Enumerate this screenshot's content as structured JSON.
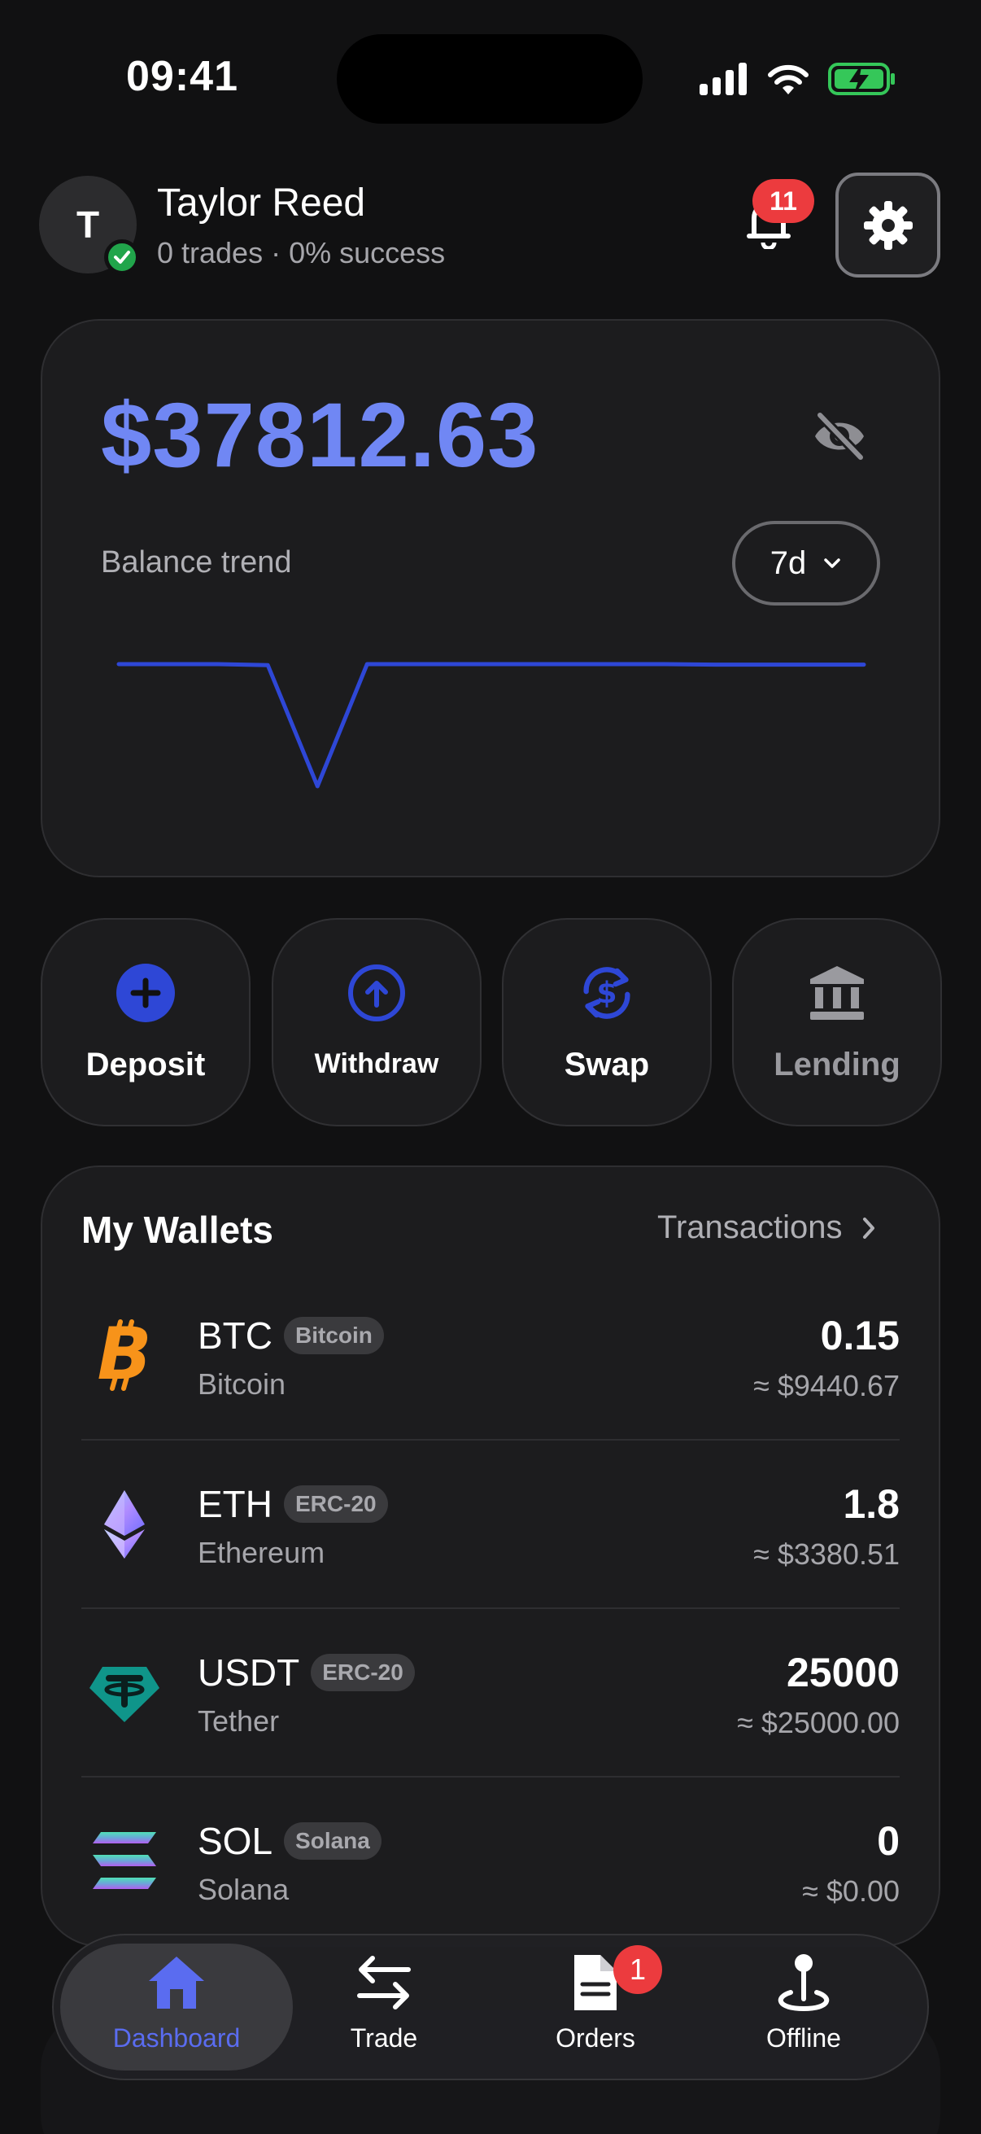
{
  "status_bar": {
    "time": "09:41"
  },
  "user": {
    "initial": "T",
    "name": "Taylor Reed",
    "stats": "0 trades · 0% success"
  },
  "notifications": {
    "count": "11"
  },
  "balance": {
    "amount": "$37812.63",
    "trend_label": "Balance trend",
    "period": "7d"
  },
  "chart_data": {
    "type": "line",
    "title": "Balance trend",
    "x": [
      0,
      1,
      2,
      3,
      4,
      5,
      6,
      7,
      8,
      9,
      10,
      11,
      12,
      13,
      14,
      15
    ],
    "series": [
      {
        "values": [
          37812,
          37812,
          37812,
          37810,
          37560,
          37812,
          37812,
          37812,
          37812,
          37812,
          37812,
          37812,
          37811,
          37811,
          37811,
          37811
        ]
      }
    ],
    "grid": false
  },
  "actions": [
    {
      "label": "Deposit",
      "icon": "plus-circle-icon"
    },
    {
      "label": "Withdraw",
      "icon": "arrow-up-circle-icon"
    },
    {
      "label": "Swap",
      "icon": "swap-dollar-icon"
    },
    {
      "label": "Lending",
      "icon": "bank-icon"
    }
  ],
  "wallets": {
    "title": "My Wallets",
    "transactions_link": "Transactions",
    "items": [
      {
        "symbol": "BTC",
        "tag": "Bitcoin",
        "name": "Bitcoin",
        "amount": "0.15",
        "fiat": "≈ $9440.67",
        "icon": "bitcoin-icon"
      },
      {
        "symbol": "ETH",
        "tag": "ERC-20",
        "name": "Ethereum",
        "amount": "1.8",
        "fiat": "≈ $3380.51",
        "icon": "ethereum-icon"
      },
      {
        "symbol": "USDT",
        "tag": "ERC-20",
        "name": "Tether",
        "amount": "25000",
        "fiat": "≈ $25000.00",
        "icon": "tether-icon"
      },
      {
        "symbol": "SOL",
        "tag": "Solana",
        "name": "Solana",
        "amount": "0",
        "fiat": "≈ $0.00",
        "icon": "solana-icon"
      }
    ]
  },
  "tabbar": {
    "tabs": [
      {
        "label": "Dashboard",
        "icon": "home-icon",
        "active": true
      },
      {
        "label": "Trade",
        "icon": "arrows-swap-icon"
      },
      {
        "label": "Orders",
        "icon": "document-icon",
        "badge": "1"
      },
      {
        "label": "Offline",
        "icon": "location-pin-icon"
      }
    ]
  },
  "colors": {
    "background": "#111112",
    "card": "#1c1c1e",
    "accent": "#7087f4",
    "accent_strong": "#2e47d6",
    "badge_red": "#ec3b3e",
    "verified_green": "#21a54b"
  }
}
